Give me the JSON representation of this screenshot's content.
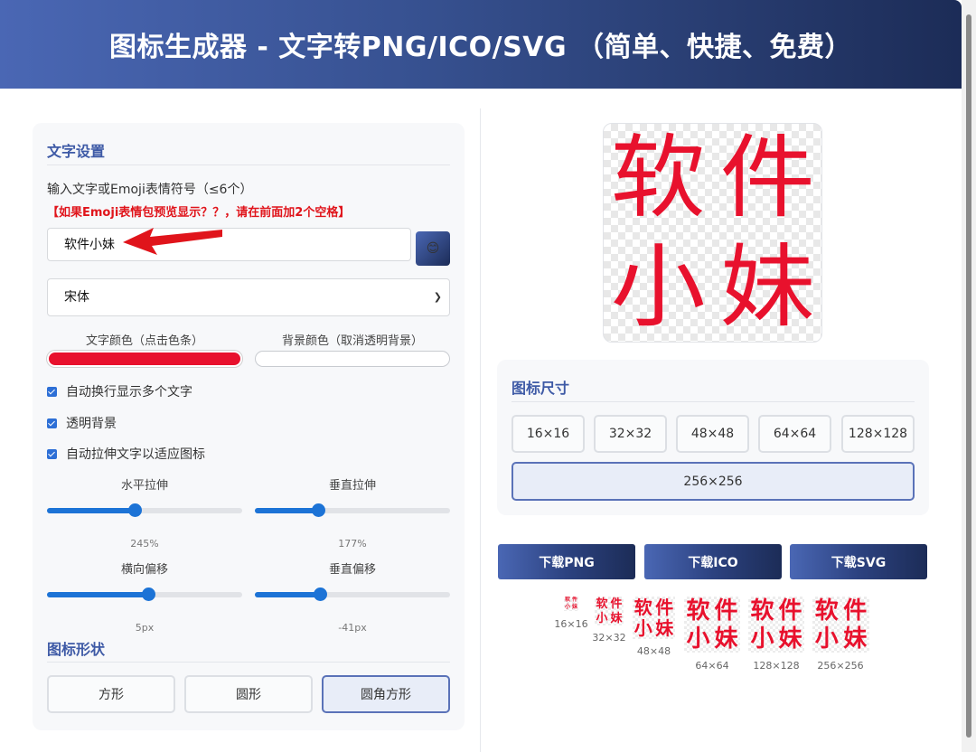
{
  "header": {
    "title": "图标生成器 - 文字转PNG/ICO/SVG （简单、快捷、免费）"
  },
  "text_settings": {
    "section_title": "文字设置",
    "input_label": "输入文字或Emoji表情符号（≤6个）",
    "warning": "【如果Emoji表情包预览显示？？，请在前面加2个空格】",
    "input_value": "软件小妹",
    "emoji_button": "😊",
    "font_value": "宋体",
    "text_color_label": "文字颜色（点击色条）",
    "bg_color_label": "背景颜色（取消透明背景）",
    "text_color": "#e8112d",
    "checkboxes": [
      {
        "label": "自动换行显示多个文字",
        "checked": true
      },
      {
        "label": "透明背景",
        "checked": true
      },
      {
        "label": "自动拉伸文字以适应图标",
        "checked": true
      }
    ],
    "sliders": {
      "h_stretch": {
        "label": "水平拉伸",
        "value": "245%"
      },
      "v_stretch": {
        "label": "垂直拉伸",
        "value": "177%"
      },
      "h_offset": {
        "label": "横向偏移",
        "value": "5px"
      },
      "v_offset": {
        "label": "垂直偏移",
        "value": "-41px"
      }
    }
  },
  "shape": {
    "section_title": "图标形状",
    "options": [
      "方形",
      "圆形",
      "圆角方形"
    ],
    "selected": "圆角方形"
  },
  "preview": {
    "chars": [
      "软",
      "件",
      "小",
      "妹"
    ]
  },
  "sizes": {
    "section_title": "图标尺寸",
    "options": [
      "16×16",
      "32×32",
      "48×48",
      "64×64",
      "128×128",
      "256×256"
    ],
    "selected": "256×256"
  },
  "downloads": [
    "下载PNG",
    "下载ICO",
    "下载SVG"
  ],
  "thumbnails": [
    "16×16",
    "32×32",
    "48×48",
    "64×64",
    "128×128",
    "256×256"
  ]
}
